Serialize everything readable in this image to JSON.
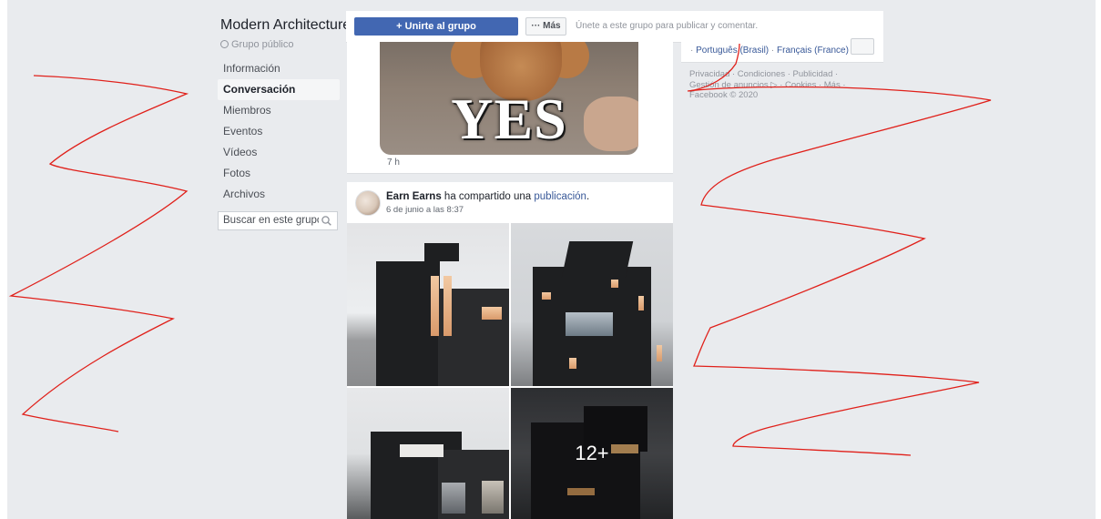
{
  "group": {
    "title": "Modern Architecture",
    "privacy": "Grupo público"
  },
  "nav": {
    "items": [
      {
        "label": "Información"
      },
      {
        "label": "Conversación",
        "active": true
      },
      {
        "label": "Miembros"
      },
      {
        "label": "Eventos"
      },
      {
        "label": "Vídeos"
      },
      {
        "label": "Fotos"
      },
      {
        "label": "Archivos"
      }
    ],
    "search_placeholder": "Buscar en este grupo"
  },
  "joinbar": {
    "join_label": "+ Unirte al grupo",
    "more_label": "··· Más",
    "hint": "Únete a este grupo para publicar y comentar."
  },
  "post1": {
    "meme_text": "YES",
    "time": "7 h"
  },
  "post2": {
    "author": "Earn Earns",
    "action": " ha compartido una ",
    "link": "publicación",
    "end": ".",
    "date": "6 de junio a las 8:37",
    "more_photos": "12+"
  },
  "sidebar_right": {
    "lang1": "Português (Brasil)",
    "lang2": "Français (France)",
    "footer_line1": "Privacidad · Condiciones · Publicidad ·",
    "footer_line2": "Gestión de anuncios ▷ · Cookies · Más ·",
    "footer_line3": "Facebook © 2020"
  },
  "colors": {
    "page_bg": "#e9ebee",
    "brand_blue": "#4267b2",
    "link_blue": "#385898",
    "scribble_red": "#e0201a"
  }
}
